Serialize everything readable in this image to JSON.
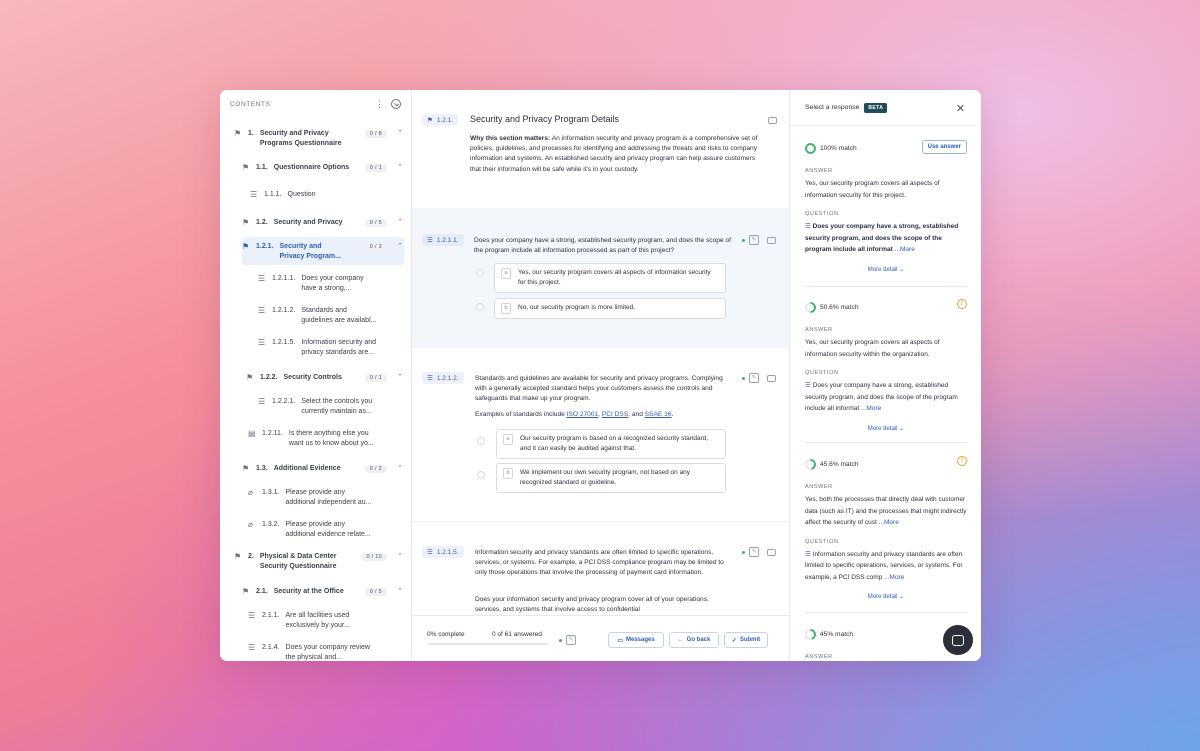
{
  "sidebar": {
    "title": "CONTENTS",
    "items": [
      {
        "num": "1.",
        "label": "Security and Privacy",
        "label2": "Programs Questionnaire",
        "count": "0 / 8"
      },
      {
        "num": "1.1.",
        "label": "Questionnaire Options",
        "count": "0 / 1"
      },
      {
        "num": "1.1.1.",
        "label": "Question"
      },
      {
        "num": "1.2.",
        "label": "Security and Privacy",
        "count": "0 / 5"
      },
      {
        "num": "1.2.1.",
        "label": "Security and",
        "label2": "Privacy Program...",
        "count": "0 / 3"
      },
      {
        "num": "1.2.1.1.",
        "label": "Does your company",
        "label2": "have a strong,..."
      },
      {
        "num": "1.2.1.2.",
        "label": "Standards and",
        "label2": "guidelines are availabl..."
      },
      {
        "num": "1.2.1.5.",
        "label": "Information security and",
        "label2": "privacy standards are..."
      },
      {
        "num": "1.2.2.",
        "label": "Security Controls",
        "count": "0 / 1"
      },
      {
        "num": "1.2.2.1.",
        "label": "Select the controls you",
        "label2": "currently maintain as..."
      },
      {
        "num": "1.2.11.",
        "label": "Is there anything else you",
        "label2": "want us to know about yo..."
      },
      {
        "num": "1.3.",
        "label": "Additional Evidence",
        "count": "0 / 2"
      },
      {
        "num": "1.3.1.",
        "label": "Please provide any",
        "label2": "additional independent au..."
      },
      {
        "num": "1.3.2.",
        "label": "Please provide any",
        "label2": "additional evidence relate..."
      },
      {
        "num": "2.",
        "label": "Physical & Data Center",
        "label2": "Security Questionnaire",
        "count": "0 / 10"
      },
      {
        "num": "2.1.",
        "label": "Security at the Office",
        "count": "0 / 5"
      },
      {
        "num": "2.1.1.",
        "label": "Are all facilities used",
        "label2": "exclusively by your..."
      },
      {
        "num": "2.1.4.",
        "label": "Does your company review",
        "label2": "the physical and..."
      }
    ]
  },
  "main": {
    "header": {
      "num": "1.2.1.",
      "title": "Security and Privacy Program Details",
      "why_label": "Why this section matters:",
      "why_text": " An information security and privacy program is a comprehensive set of policies, guidelines, and processes for identifying and addressing the threats and risks to company information and systems. An established security and privacy program can help assure customers that their information will be safe while it's in your custody."
    },
    "q1": {
      "num": "1.2.1.1.",
      "text": "Does your company have a strong, established security program, and does the scope of the program include all information processed as part of this project?",
      "options": [
        {
          "letter": "a",
          "text": "Yes, our security program covers all aspects of information security for this project."
        },
        {
          "letter": "b",
          "text": "No, our security program is more limited."
        }
      ]
    },
    "q2": {
      "num": "1.2.1.2.",
      "text": "Standards and guidelines are available for security and privacy programs. Complying with a generally accepted standard helps your customers assess the controls and safeguards that make up your program.",
      "examples_prefix": "Examples of standards include ",
      "ex1": "ISO 27001",
      "comma": ", ",
      "ex2": "PCI DSS",
      "and": ", and ",
      "ex3": "SSAE 16",
      "period": ".",
      "options": [
        {
          "letter": "a",
          "text": "Our security program is based on a recognized security standard, and it can easily be audited against that."
        },
        {
          "letter": "b",
          "text": "We implement our own security program, not based on any recognized standard or guideline."
        }
      ]
    },
    "q3": {
      "num": "1.2.1.5.",
      "text": "Information security and privacy standards are often limited to specific operations, services, or systems. For example, a PCI DSS compliance program may be limited to only those operations that involve the processing of payment card information.",
      "text2": "Does your information security and privacy program cover all of your operations, services, and systems that involve access to confidential"
    },
    "footer": {
      "progress": "0% complete",
      "progress_value": 0,
      "answered": "0 of 61 answered",
      "messages": "Messages",
      "go_back": "Go back",
      "submit": "Submit"
    }
  },
  "responses": {
    "title": "Select a response",
    "beta": "BETA",
    "answer_label": "ANSWER",
    "question_label": "QUESTION",
    "more": "...More",
    "more_detail": "More detail",
    "use_answer": "Use answer",
    "cards": [
      {
        "match": "100% match",
        "match_value": 100,
        "answer": "Yes, our security program covers all aspects of information security for this project.",
        "question": "Does your company have a strong, established security program, and does the scope of the program include all informat"
      },
      {
        "match": "50.6% match",
        "match_value": 50.6,
        "answer": "Yes, our security program covers all aspects of information security within the organization.",
        "question": "Does your company have a strong, established security program, and does the scope of the program include all informat"
      },
      {
        "match": "45.6% match",
        "match_value": 45.6,
        "answer": "Yes, both the processes that directly deal with customer data (such as IT) and the processes that might indirectly affect the security of cust",
        "question": "Information security and privacy standards are often limited to specific operations, services, or systems. For example, a PCI DSS comp"
      },
      {
        "match": "45% match",
        "match_value": 45
      }
    ]
  },
  "colors": {
    "accent": "#2f5fb3",
    "match": "#3ab56a",
    "warning": "#f0a030",
    "beta": "#1f4e5a"
  }
}
